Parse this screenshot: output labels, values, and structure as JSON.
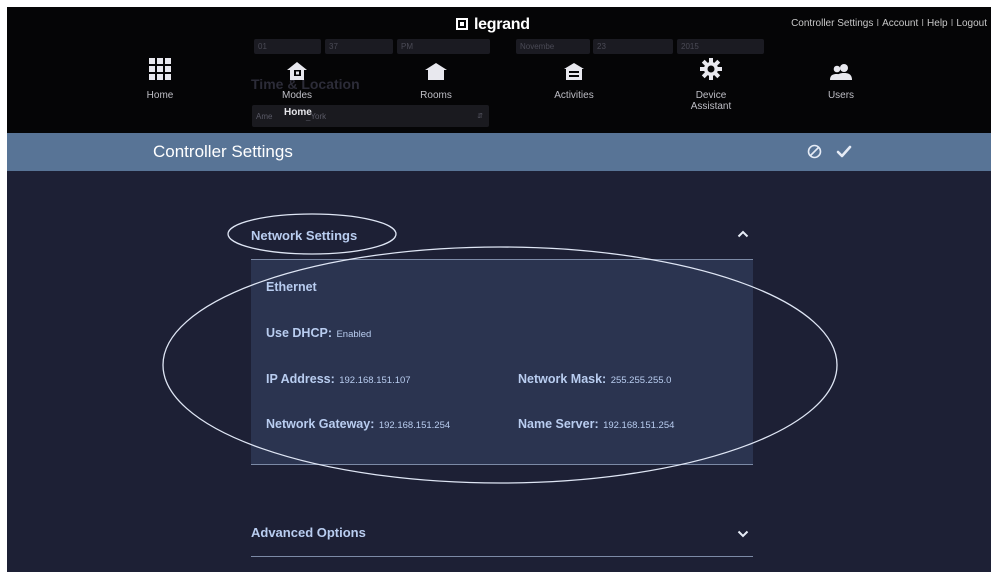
{
  "header": {
    "logo_text": "legrand",
    "links": [
      "Controller Settings",
      "Account",
      "Help",
      "Logout"
    ],
    "separator": "I"
  },
  "background_form": {
    "hour": "01",
    "minute": "37",
    "ampm": "PM",
    "month": "Novembe",
    "day": "23",
    "year": "2015",
    "section_title": "Time & Location",
    "timezone_left": "Ame",
    "timezone_right": "_York"
  },
  "nav": {
    "items": [
      {
        "label": "Home",
        "icon": "grid-icon"
      },
      {
        "label": "Modes",
        "icon": "modes-house-icon"
      },
      {
        "label": "Rooms",
        "icon": "rooms-house-icon"
      },
      {
        "label": "Activities",
        "icon": "activities-icon"
      },
      {
        "label": "Device Assistant",
        "icon": "gear-icon"
      },
      {
        "label": "Users",
        "icon": "users-icon"
      }
    ],
    "home_submenu_label": "Home"
  },
  "title_bar": {
    "title": "Controller Settings",
    "cancel_icon": "cancel-icon",
    "confirm_icon": "checkmark-icon"
  },
  "network_settings": {
    "title": "Network Settings",
    "expanded": true,
    "subsection": "Ethernet",
    "dhcp_label": "Use DHCP:",
    "dhcp_value": "Enabled",
    "ip_label": "IP Address:",
    "ip_value": "192.168.151.107",
    "mask_label": "Network Mask:",
    "mask_value": "255.255.255.0",
    "gateway_label": "Network Gateway:",
    "gateway_value": "192.168.151.254",
    "dns_label": "Name Server:",
    "dns_value": "192.168.151.254"
  },
  "advanced_options": {
    "title": "Advanced Options",
    "expanded": false
  },
  "colors": {
    "header_bg": "#050506",
    "page_bg": "#1d2035",
    "title_bar": "#587496",
    "panel_bg": "#2b3450",
    "label_text": "#b9cdf0",
    "annotation_stroke": "#dfe6f5"
  }
}
